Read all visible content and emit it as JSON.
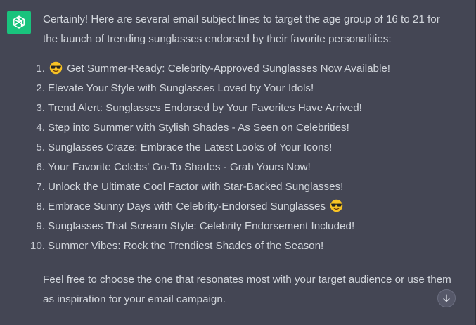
{
  "assistant": {
    "avatar_color": "#19c37d",
    "avatar_icon": "openai-logo-icon"
  },
  "message": {
    "intro": "Certainly! Here are several email subject lines to target the age group of 16 to 21 for the launch of trending sunglasses endorsed by their favorite personalities:",
    "subject_lines": [
      {
        "num": "1.",
        "text_before": "",
        "emoji": "sunglasses-emoji-icon",
        "text": "Get Summer-Ready: Celebrity-Approved Sunglasses Now Available!"
      },
      {
        "num": "2.",
        "text": "Elevate Your Style with Sunglasses Loved by Your Idols!"
      },
      {
        "num": "3.",
        "text": "Trend Alert: Sunglasses Endorsed by Your Favorites Have Arrived!"
      },
      {
        "num": "4.",
        "text": "Step into Summer with Stylish Shades - As Seen on Celebrities!"
      },
      {
        "num": "5.",
        "text": "Sunglasses Craze: Embrace the Latest Looks of Your Icons!"
      },
      {
        "num": "6.",
        "text": "Your Favorite Celebs' Go-To Shades - Grab Yours Now!"
      },
      {
        "num": "7.",
        "text": "Unlock the Ultimate Cool Factor with Star-Backed Sunglasses!"
      },
      {
        "num": "8.",
        "text": "Embrace Sunny Days with Celebrity-Endorsed Sunglasses",
        "emoji_after": "sunglasses-emoji-icon"
      },
      {
        "num": "9.",
        "text": "Sunglasses That Scream Style: Celebrity Endorsement Included!"
      },
      {
        "num": "10.",
        "text": "Summer Vibes: Rock the Trendiest Shades of the Season!"
      }
    ],
    "outro": "Feel free to choose the one that resonates most with your target audience or use them as inspiration for your email campaign."
  },
  "scroll_button": {
    "icon": "arrow-down-icon"
  },
  "colors": {
    "background": "#444654",
    "text": "#d1d5db",
    "brand": "#19c37d"
  }
}
